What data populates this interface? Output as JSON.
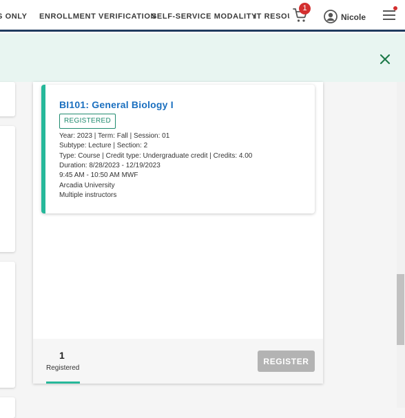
{
  "nav": {
    "links": [
      "S ONLY",
      "ENROLLMENT VERIFICATION",
      "SELF-SERVICE MODALITY",
      "IT RESOU"
    ],
    "cart_icon": "cart-icon",
    "cart_count": "1",
    "user_icon": "user-icon",
    "user_name": "Nicole",
    "menu_icon": "hamburger-menu-icon"
  },
  "banner": {
    "close_icon": "close-icon"
  },
  "course": {
    "title": "BI101: General Biology I",
    "status": "REGISTERED",
    "details": [
      "Year: 2023 | Term: Fall | Session: 01",
      "Subtype: Lecture | Section: 2",
      "Type: Course | Credit type: Undergraduate credit | Credits: 4.00",
      "Duration: 8/28/2023 - 12/19/2023",
      "9:45 AM - 10:50 AM MWF",
      "Arcadia University",
      "Multiple instructors"
    ]
  },
  "footer": {
    "registered_count": "1",
    "registered_label": "Registered",
    "register_button": "REGISTER"
  },
  "colors": {
    "accent": "#26b89a",
    "link": "#1a6fbf",
    "nav_border": "#1f3a5f",
    "badge": "#d32f2f",
    "banner_bg": "#e8f5f1",
    "close_icon": "#1e7a4a"
  }
}
